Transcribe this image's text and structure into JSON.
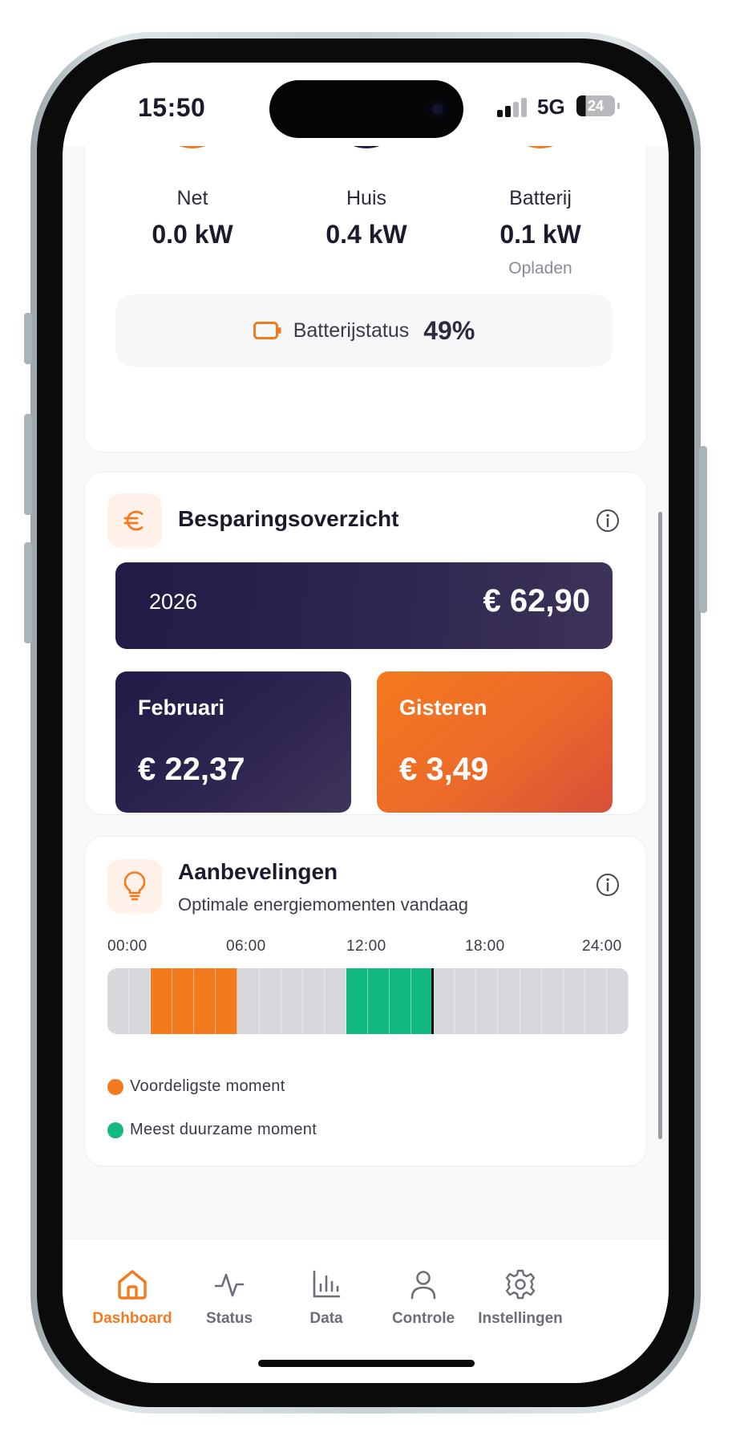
{
  "status_bar": {
    "time": "15:50",
    "network": "5G",
    "battery": "24"
  },
  "flow": {
    "net": {
      "label": "Net",
      "value": "0.0 kW"
    },
    "house": {
      "label": "Huis",
      "value": "0.4 kW"
    },
    "battery": {
      "label": "Batterij",
      "value": "0.1 kW",
      "sub": "Opladen"
    },
    "battery_status": {
      "label": "Batterijstatus",
      "value": "49%",
      "level": 0.49
    }
  },
  "savings": {
    "icon": "euro-icon",
    "title": "Besparingsoverzicht",
    "year": {
      "label": "2026",
      "value": "€ 62,90"
    },
    "month": {
      "label": "Februari",
      "value": "€ 22,37"
    },
    "yesterday": {
      "label": "Gisteren",
      "value": "€ 3,49"
    }
  },
  "recommendations": {
    "icon": "lightbulb-icon",
    "title": "Aanbevelingen",
    "subtitle": "Optimale energiemomenten vandaag",
    "time_labels": [
      "00:00",
      "06:00",
      "12:00",
      "18:00",
      "24:00"
    ],
    "slot_count": 24,
    "cheapest_slots": [
      2,
      3,
      4,
      5
    ],
    "greenest_slots": [
      11,
      12,
      13,
      14
    ],
    "current_slot_end": 15,
    "legend": {
      "cheapest": "Voordeligste moment",
      "greenest": "Meest duurzame moment"
    }
  },
  "colors": {
    "accent": "#f47a1e",
    "green": "#12b981",
    "navy": "#221b46",
    "slot_empty": "#d6d8dc"
  },
  "tabs": [
    {
      "label": "Dashboard",
      "icon": "home-icon",
      "active": true
    },
    {
      "label": "Status",
      "icon": "activity-icon",
      "active": false
    },
    {
      "label": "Data",
      "icon": "bar-chart-icon",
      "active": false
    },
    {
      "label": "Controle",
      "icon": "user-icon",
      "active": false
    },
    {
      "label": "Instellingen",
      "icon": "gear-icon",
      "active": false
    }
  ]
}
